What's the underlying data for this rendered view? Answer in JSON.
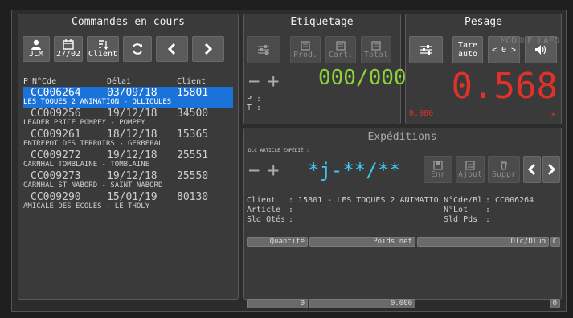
{
  "commandes": {
    "title": "Commandes en cours",
    "btn_user": "JLM",
    "btn_date": "27/02",
    "btn_client": "Client",
    "hdr_p": "P",
    "hdr_code": "N°Cde",
    "hdr_delai": "Délai",
    "hdr_client": "Client",
    "rows": [
      {
        "code": "CC006264",
        "date": "03/09/18",
        "client": "15801",
        "name": "LES TOQUES 2 ANIMATION - OLLIOULES"
      },
      {
        "code": "CC009256",
        "date": "19/12/18",
        "client": "34500",
        "name": "LEADER PRICE POMPEY - POMPEY"
      },
      {
        "code": "CC009261",
        "date": "18/12/18",
        "client": "15365",
        "name": "ENTREPOT DES TERROIRS - GERBEPAL"
      },
      {
        "code": "CC009272",
        "date": "19/12/18",
        "client": "25551",
        "name": "CARNHAL TOMBLAINE - TOMBLAINE"
      },
      {
        "code": "CC009273",
        "date": "19/12/18",
        "client": "25550",
        "name": "CARNHAL ST NABORD - SAINT NABORD"
      },
      {
        "code": "CC009290",
        "date": "15/01/19",
        "client": "80130",
        "name": "AMICALE DES ECOLES - LE THOLY"
      }
    ]
  },
  "etiquetage": {
    "title": "Etiquetage",
    "prod": "Prod.",
    "cart": "Cart.",
    "total": "Total",
    "minus": "−",
    "plus": "+",
    "counter": "000/000",
    "p_label": "P :",
    "t_label": "T :"
  },
  "pesage": {
    "title": "Pesage",
    "tare_line1": "Tare",
    "tare_line2": "auto",
    "zero": "< 0 >",
    "watermark": "MODULE LAFO",
    "weight": "0.568",
    "tare_value": "0.000",
    "star": "*"
  },
  "expeditions": {
    "title": "Expéditions",
    "dlc_label": "DLC ARTICLE EXPÉDIÉ :",
    "minus": "−",
    "plus": "+",
    "dlc_value": "*j-**/**",
    "enr": "Enr",
    "ajout": "Ajout",
    "suppr": "Suppr",
    "client_label": "Client",
    "client_value": ": 15801 - LES TOQUES 2 ANIMATIO",
    "ncde_label": "N°Cde/Bl",
    "ncde_value": ": CC006264",
    "article_label": "Article",
    "article_value": ":",
    "nlot_label": "N°Lot",
    "nlot_value": ":",
    "sldqtes_label": "Sld Qtés",
    "sldqtes_value": ":",
    "sldpds_label": "Sld Pds",
    "sldpds_value": ":",
    "col_quantite": "Quantité",
    "col_poids": "Poids net",
    "col_dlc": "Dlc/Dluo",
    "col_c": "C",
    "tot_quantite": "0",
    "tot_poids": "0.000",
    "tot_c": "0"
  },
  "colors": {
    "accent": "#1a73d9",
    "green": "#8fd23a",
    "red": "#e0312a",
    "cyan": "#3cc8f0"
  }
}
